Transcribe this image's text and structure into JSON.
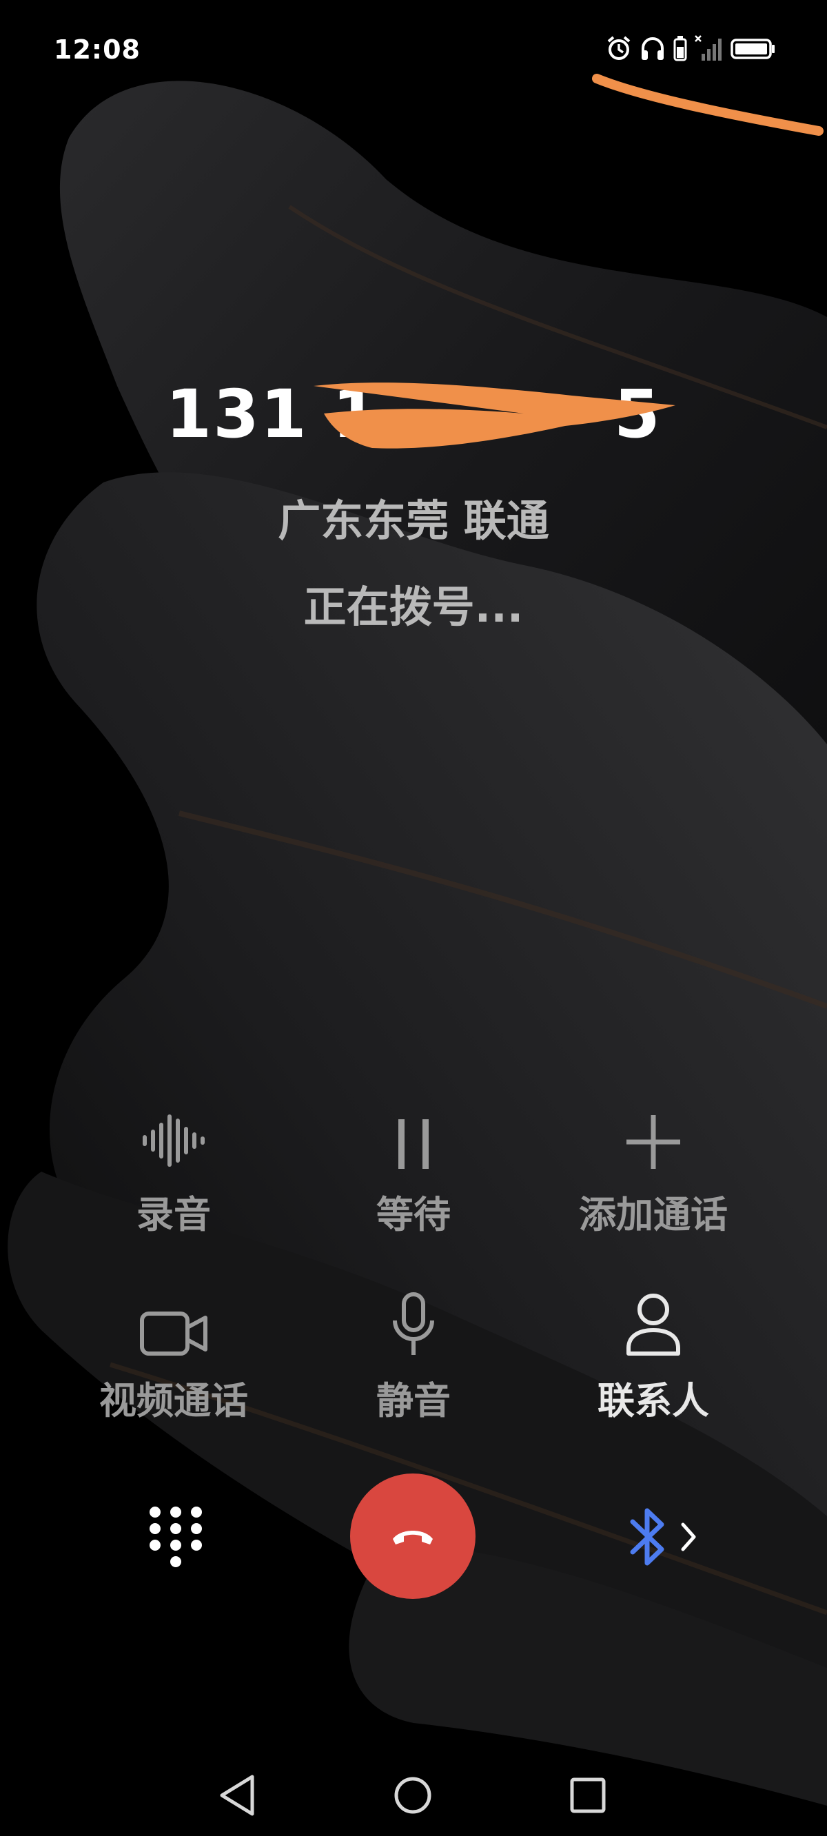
{
  "status_bar": {
    "time": "12:08",
    "icons": [
      "alarm-icon",
      "headphones-icon",
      "battery-saver-icon",
      "signal-no-service-icon",
      "battery-icon"
    ]
  },
  "call": {
    "number": "131 1",
    "number_suffix": "5",
    "number_redacted": true,
    "location": "广东东莞 联通",
    "status": "正在拨号..."
  },
  "actions": {
    "record": {
      "label": "录音",
      "icon": "waveform-icon"
    },
    "hold": {
      "label": "等待",
      "icon": "pause-icon"
    },
    "add_call": {
      "label": "添加通话",
      "icon": "plus-icon"
    },
    "video_call": {
      "label": "视频通话",
      "icon": "video-camera-icon"
    },
    "mute": {
      "label": "静音",
      "icon": "microphone-icon"
    },
    "contacts": {
      "label": "联系人",
      "icon": "person-icon"
    }
  },
  "controls": {
    "keypad_icon": "dialpad-icon",
    "end_call_icon": "phone-hangup-icon",
    "audio_route_icon": "bluetooth-icon"
  },
  "nav_bar": {
    "icons": [
      "back-triangle-icon",
      "home-circle-icon",
      "recents-square-icon"
    ]
  },
  "colors": {
    "end_call": "#d9473f",
    "bluetooth": "#4d7cf0",
    "redaction": "#f0904a",
    "label_dim": "#9a9a9a"
  }
}
